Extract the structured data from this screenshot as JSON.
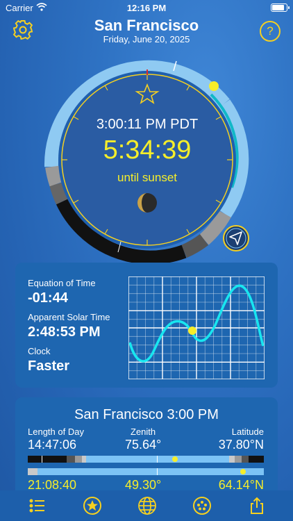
{
  "status_bar": {
    "carrier": "Carrier",
    "time": "12:16 PM"
  },
  "header": {
    "city": "San Francisco",
    "date": "Friday, June 20, 2025",
    "help_label": "?"
  },
  "dial": {
    "current_time": "3:00:11 PM PDT",
    "countdown": "5:34:39",
    "countdown_label": "until sunset"
  },
  "equation_card": {
    "equation_label": "Equation of Time",
    "equation_value": "-01:44",
    "solar_label": "Apparent Solar Time",
    "solar_value": "2:48:53 PM",
    "clock_label": "Clock",
    "clock_value": "Faster"
  },
  "info_card": {
    "title": "San Francisco 3:00 PM",
    "length_label": "Length of Day",
    "length_value": "14:47:06",
    "zenith_label": "Zenith",
    "zenith_value": "75.64°",
    "latitude_label": "Latitude",
    "latitude_value": "37.80°N",
    "night_value": "21:08:40",
    "altitude_value": "49.30°",
    "second_latitude_value": "64.14°N"
  },
  "tabs": [
    {
      "icon": "list-icon"
    },
    {
      "icon": "star-icon"
    },
    {
      "icon": "globe-icon"
    },
    {
      "icon": "dots-icon"
    },
    {
      "icon": "share-icon"
    }
  ],
  "colors": {
    "accent": "#f5d020",
    "sky": "#7cc3f5",
    "curve": "#18e6f0"
  }
}
